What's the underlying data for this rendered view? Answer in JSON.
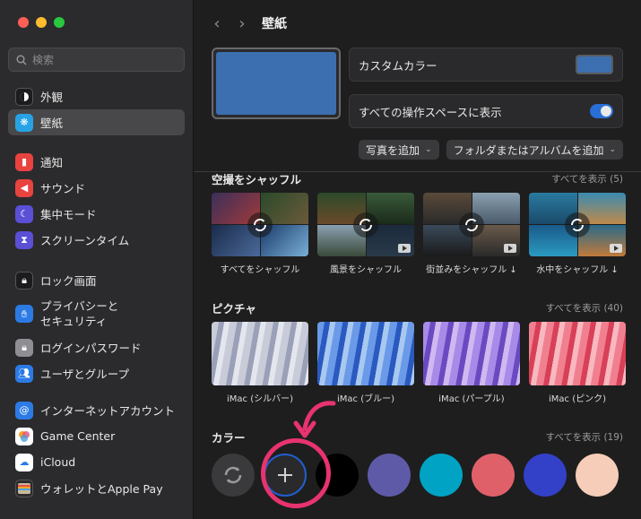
{
  "sidebar": {
    "search_placeholder": "検索",
    "items": [
      {
        "label": "外観",
        "icon": "appearance-icon",
        "color": "#1c1c1e"
      },
      {
        "label": "壁紙",
        "icon": "wallpaper-icon",
        "color": "#27a3e5"
      },
      {
        "label": "通知",
        "icon": "bell-icon",
        "color": "#e8433f"
      },
      {
        "label": "サウンド",
        "icon": "speaker-icon",
        "color": "#e8433f"
      },
      {
        "label": "集中モード",
        "icon": "moon-icon",
        "color": "#5b4fd6"
      },
      {
        "label": "スクリーンタイム",
        "icon": "hourglass-icon",
        "color": "#5b4fd6"
      },
      {
        "label": "ロック画面",
        "icon": "lock-screen-icon",
        "color": "#1c1c1e"
      },
      {
        "label": "プライバシーと\nセキュリティ",
        "icon": "hand-icon",
        "color": "#2c7be5"
      },
      {
        "label": "ログインパスワード",
        "icon": "lock-icon",
        "color": "#8e8e93"
      },
      {
        "label": "ユーザとグループ",
        "icon": "users-icon",
        "color": "#2c7be5"
      },
      {
        "label": "インターネットアカウント",
        "icon": "at-icon",
        "color": "#2c7be5"
      },
      {
        "label": "Game Center",
        "icon": "game-center-icon",
        "color": "#ffffff"
      },
      {
        "label": "iCloud",
        "icon": "cloud-icon",
        "color": "#ffffff"
      },
      {
        "label": "ウォレットとApple Pay",
        "icon": "wallet-icon",
        "color": "#2c2c2e"
      }
    ]
  },
  "header": {
    "title": "壁紙",
    "back": "‹",
    "forward": "›"
  },
  "options": {
    "custom_color_label": "カスタムカラー",
    "custom_color": "#3c6fb0",
    "all_spaces_label": "すべての操作スペースに表示",
    "add_photo": "写真を追加",
    "add_folder": "フォルダまたはアルバムを追加"
  },
  "sections": {
    "shuffle": {
      "title": "空撮をシャッフル",
      "link": "すべてを表示 (5)",
      "tiles": [
        "すべてをシャッフル",
        "風景をシャッフル",
        "街並みをシャッフル ↓",
        "水中をシャッフル ↓"
      ]
    },
    "pictures": {
      "title": "ピクチャ",
      "link": "すべてを表示 (40)",
      "tiles": [
        "iMac (シルバー)",
        "iMac (ブルー)",
        "iMac (パープル)",
        "iMac (ピンク)"
      ]
    },
    "colors": {
      "title": "カラー",
      "link": "すべてを表示 (19)",
      "swatches": [
        "#000000",
        "#5e5aa8",
        "#00a3c4",
        "#e0606a",
        "#3340c8",
        "#f5cdb8"
      ]
    }
  }
}
